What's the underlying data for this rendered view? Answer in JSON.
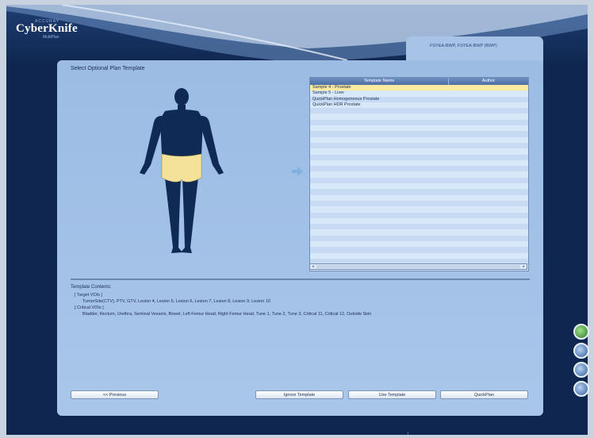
{
  "brand": {
    "logo_text": "CyberKnife",
    "logo_top": "ACCURAY",
    "logo_sub": "MultiPlan"
  },
  "header_tab": {
    "label": "FSYEA-BWP, FSYEA-BWP (BWP)"
  },
  "panel": {
    "title": "Select Optional Plan Template"
  },
  "template_table": {
    "columns": [
      "Template Name",
      "Author"
    ],
    "rows": [
      {
        "name": "Sample 4 - Prostate",
        "author": "",
        "selected": true
      },
      {
        "name": "Sample 5 - Liver",
        "author": "",
        "selected": false
      },
      {
        "name": "QuickPlan Homogeneous Prostate",
        "author": "",
        "selected": false
      },
      {
        "name": "QuickPlan HDR Prostate",
        "author": "",
        "selected": false
      }
    ],
    "empty_row_count": 28
  },
  "template_contents": {
    "label": "Template Contents:",
    "target_header": "[ Target VOIs ]",
    "target_list": "TumorSite(CTV), PTV, GTV, Lesion 4, Lesion 5, Lesion 6, Lesion 7, Lesion 8, Lesion 9, Lesion 10",
    "critical_header": "[ Critical VOIs ]",
    "critical_list": "Bladder, Rectum, Urethra, Seminal Vessels, Bowel, Left Femur Head, Right Femur Head, Tune 1, Tune 2, Tune 3, Critical 11, Critical 12, Outside Skin"
  },
  "buttons": {
    "previous": "<< Previous",
    "ignore_template": "Ignore Template",
    "use_template": "Use Template",
    "quickplan": "QuickPlan"
  },
  "colors": {
    "highlight_region": "#f5e29a",
    "selected_row": "#fbeaa0",
    "body_silhouette": "#0f2a55",
    "arrow": "#7fb0e0"
  },
  "side_icons": [
    "status-green-icon",
    "tool-icon",
    "tool-icon",
    "tool-icon"
  ]
}
